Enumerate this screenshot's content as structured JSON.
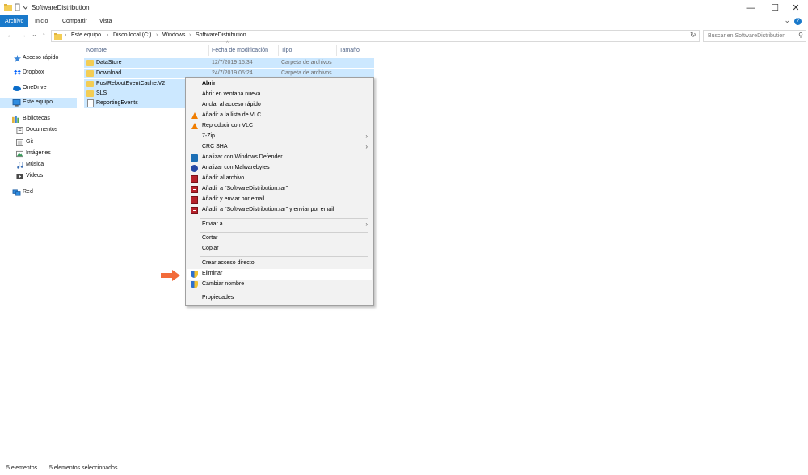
{
  "window": {
    "title": "SoftwareDistribution",
    "minimize_glyph": "—",
    "maximize_glyph": "☐",
    "close_glyph": "✕",
    "icons": [
      "folder-icon",
      "undo-icon",
      "dropdown-arrow-icon"
    ]
  },
  "ribbon": {
    "tabs": [
      {
        "label": "Archivo",
        "active": true
      },
      {
        "label": "Inicio",
        "active": false
      },
      {
        "label": "Compartir",
        "active": false
      },
      {
        "label": "Vista",
        "active": false
      }
    ],
    "help_glyph": "?",
    "expand_glyph": "⌄"
  },
  "address": {
    "back_glyph": "←",
    "forward_glyph": "→",
    "recent_glyph": "⌄",
    "up_glyph": "↑",
    "separator": "›",
    "breadcrumbs": [
      "Este equipo",
      "Disco local (C:)",
      "Windows",
      "SoftwareDistribution"
    ],
    "refresh_glyph": "↻",
    "dropdown_glyph": "⌄",
    "search_placeholder": "Buscar en SoftwareDistribution",
    "search_glyph": "⚲"
  },
  "nav_pane": {
    "items": [
      {
        "label": "Acceso rápido",
        "icon": "star-icon",
        "selected": false
      },
      {
        "label": "Dropbox",
        "icon": "dropbox-icon",
        "selected": false
      },
      {
        "label": "OneDrive",
        "icon": "cloud-icon",
        "selected": false
      },
      {
        "label": "Este equipo",
        "icon": "computer-icon",
        "selected": true
      },
      {
        "label": "Bibliotecas",
        "icon": "library-icon",
        "selected": false
      },
      {
        "label": "Documentos",
        "icon": "documents-icon",
        "selected": false
      },
      {
        "label": "Git",
        "icon": "git-icon",
        "selected": false
      },
      {
        "label": "Imágenes",
        "icon": "images-icon",
        "selected": false
      },
      {
        "label": "Música",
        "icon": "music-icon",
        "selected": false
      },
      {
        "label": "Videos",
        "icon": "videos-icon",
        "selected": false
      },
      {
        "label": "Red",
        "icon": "network-icon",
        "selected": false
      }
    ]
  },
  "file_list": {
    "columns": [
      "Nombre",
      "Fecha de modificación",
      "Tipo",
      "Tamaño"
    ],
    "sort_glyph": "^",
    "rows": [
      {
        "name": "DataStore",
        "date": "12/7/2019 15:34",
        "type": "Carpeta de archivos",
        "kind": "folder"
      },
      {
        "name": "Download",
        "date": "24/7/2019 05:24",
        "type": "Carpeta de archivos",
        "kind": "folder"
      },
      {
        "name": "PostRebootEventCache.V2",
        "date": "",
        "type": "",
        "kind": "folder"
      },
      {
        "name": "SLS",
        "date": "",
        "type": "",
        "kind": "folder"
      },
      {
        "name": "ReportingEvents",
        "date": "",
        "type": "",
        "kind": "file"
      }
    ]
  },
  "context_menu": {
    "arrow_glyph": "›",
    "items": [
      {
        "label": "Abrir",
        "bold": true
      },
      {
        "label": "Abrir en ventana nueva"
      },
      {
        "label": "Anclar al acceso rápido"
      },
      {
        "label": "Añadir a la lista de VLC",
        "icon": "vlc-icon"
      },
      {
        "label": "Reproducir con VLC",
        "icon": "vlc-icon"
      },
      {
        "label": "7-Zip",
        "submenu": true
      },
      {
        "label": "CRC SHA",
        "submenu": true
      },
      {
        "label": "Analizar con Windows Defender...",
        "icon": "windows-defender-icon"
      },
      {
        "label": "Analizar con Malwarebytes",
        "icon": "malwarebytes-icon"
      },
      {
        "label": "Añadir al archivo...",
        "icon": "winrar-icon"
      },
      {
        "label": "Añadir a \"SoftwareDistribution.rar\"",
        "icon": "winrar-icon"
      },
      {
        "label": "Añadir y enviar por email...",
        "icon": "winrar-icon"
      },
      {
        "label": "Añadir a \"SoftwareDistribution.rar\" y enviar por email",
        "icon": "winrar-icon"
      },
      {
        "label": "Enviar a",
        "submenu": true
      },
      {
        "label": "Cortar"
      },
      {
        "label": "Copiar"
      },
      {
        "label": "Crear acceso directo"
      },
      {
        "label": "Eliminar",
        "icon": "admin-shield-icon",
        "highlighted": true
      },
      {
        "label": "Cambiar nombre",
        "icon": "admin-shield-icon"
      },
      {
        "label": "Propiedades"
      }
    ]
  },
  "status_bar": {
    "count": "5 elementos",
    "selected": "5 elementos seleccionados"
  },
  "colors": {
    "accent": "#1979ca",
    "selection": "#cce8ff",
    "folder": "#f3cd55",
    "annotation_arrow": "#f26b3a"
  }
}
